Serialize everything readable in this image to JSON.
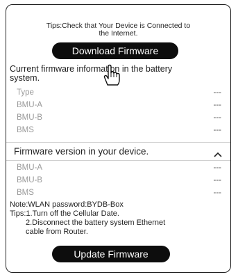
{
  "tips_top": {
    "line1": "Tips:Check that Your Device is Connected to",
    "line2": "the Internet."
  },
  "download_button": {
    "label": "Download Firmware"
  },
  "current_info": {
    "line1": "Current firmware information in the battery",
    "line2": "system."
  },
  "battery_rows": [
    {
      "label": "Type",
      "value": "---"
    },
    {
      "label": "BMU-A",
      "value": "---"
    },
    {
      "label": "BMU-B",
      "value": "---"
    },
    {
      "label": "BMS",
      "value": "---"
    }
  ],
  "device_section": {
    "title": "Firmware version in your device.",
    "chevron_icon": "chevron-up-icon"
  },
  "device_rows": [
    {
      "label": "BMU-A",
      "value": "---"
    },
    {
      "label": "BMU-B",
      "value": "---"
    },
    {
      "label": "BMS",
      "value": "---"
    }
  ],
  "notes": {
    "wlan": "Note:WLAN password:BYDB-Box",
    "tip1": "Tips:1.Turn off the Cellular Date.",
    "tip2a": "2.Disconnect the battery system Ethernet",
    "tip2b": "cable from Router."
  },
  "update_button": {
    "label": "Update Firmware"
  },
  "cursor_icon": "hand-pointer-icon"
}
